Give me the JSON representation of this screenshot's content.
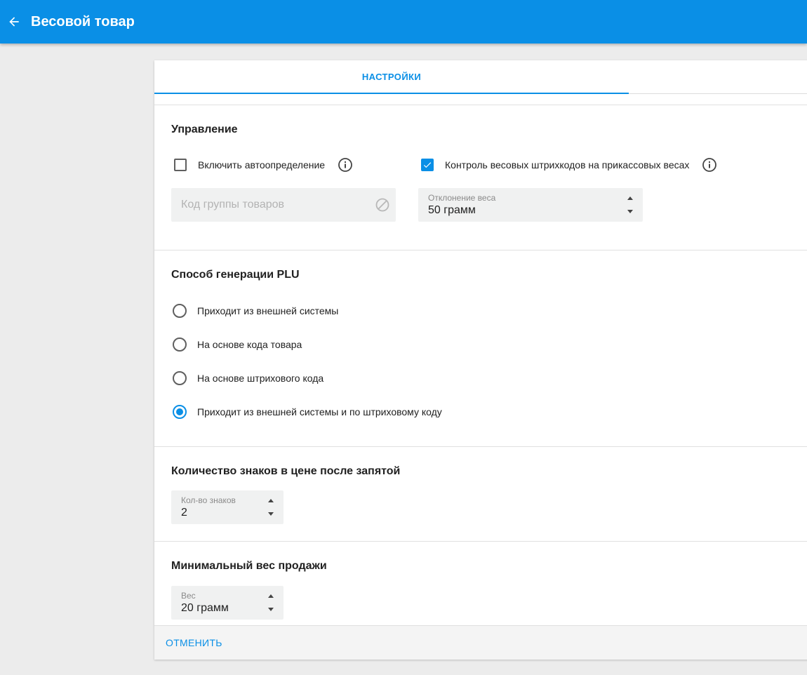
{
  "appbar": {
    "title": "Весовой товар",
    "back_icon": "arrow-left-icon",
    "color": "#0a8fe6"
  },
  "tabs": [
    {
      "label": "НАСТРОЙКИ",
      "active": true
    }
  ],
  "management": {
    "title": "Управление",
    "autodetect": {
      "label": "Включить автоопределение",
      "checked": false
    },
    "barcode_control": {
      "label": "Контроль весовых штрихкодов на прикассовых весах",
      "checked": true
    },
    "group_code": {
      "placeholder": "Код группы товаров",
      "disabled": true
    },
    "weight_deviation": {
      "label": "Отклонение веса",
      "value": "50 грамм"
    }
  },
  "plu": {
    "title": "Способ генерации PLU",
    "options": [
      {
        "label": "Приходит из внешней системы",
        "selected": false
      },
      {
        "label": "На основе кода товара",
        "selected": false
      },
      {
        "label": "На основе штрихового кода",
        "selected": false
      },
      {
        "label": "Приходит из внешней системы и по штриховому коду",
        "selected": true
      }
    ]
  },
  "decimals": {
    "title": "Количество знаков в цене после запятой",
    "field": {
      "label": "Кол-во знаков",
      "value": "2"
    }
  },
  "min_weight": {
    "title": "Минимальный вес продажи",
    "field": {
      "label": "Вес",
      "value": "20 грамм"
    }
  },
  "footer": {
    "cancel_label": "ОТМЕНИТЬ"
  },
  "colors": {
    "accent": "#0a8fe6",
    "background": "#ececec"
  }
}
